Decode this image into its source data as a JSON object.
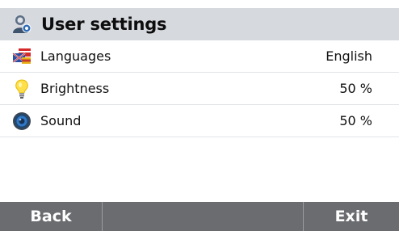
{
  "header": {
    "title": "User settings",
    "icon": "user-settings-icon"
  },
  "settings": [
    {
      "label": "Languages",
      "value": "English",
      "icon": "flags-icon"
    },
    {
      "label": "Brightness",
      "value": "50 %",
      "icon": "light-bulb-icon"
    },
    {
      "label": "Sound",
      "value": "50 %",
      "icon": "speaker-icon"
    }
  ],
  "footer": {
    "back_label": "Back",
    "middle_label": "",
    "exit_label": "Exit"
  },
  "colors": {
    "header_bg": "#d6d9de",
    "footer_bg": "#6a6c70"
  }
}
